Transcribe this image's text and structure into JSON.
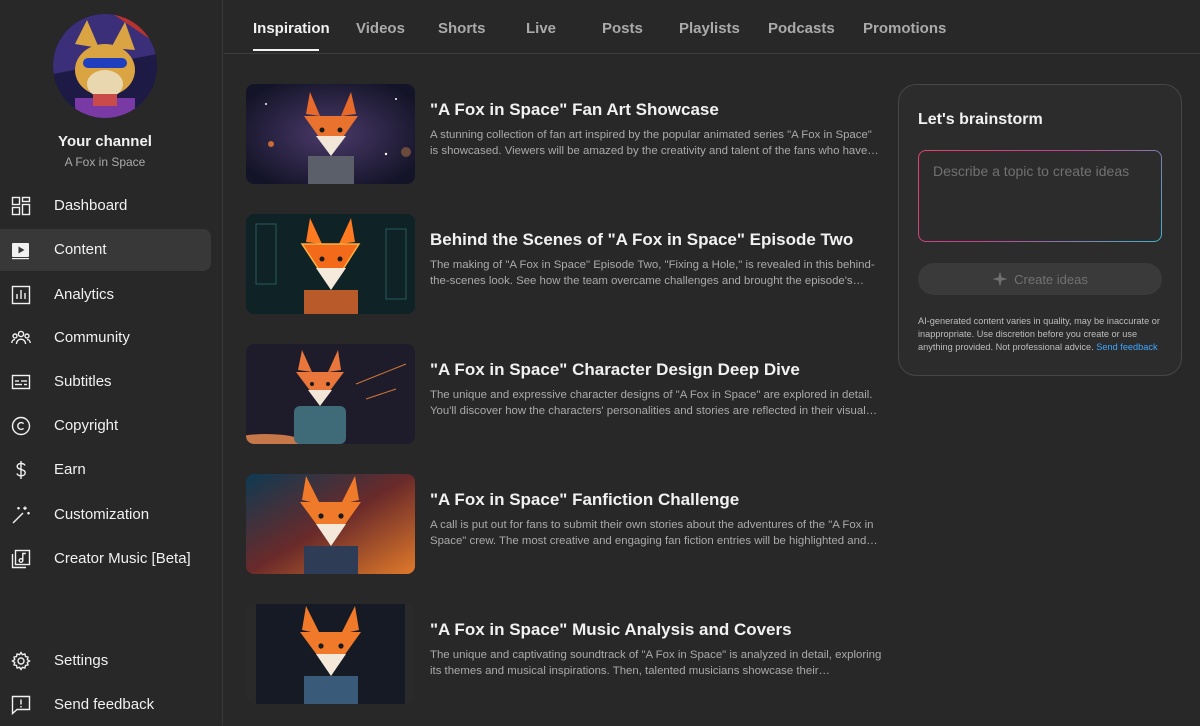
{
  "channel": {
    "title": "Your channel",
    "name": "A Fox in Space"
  },
  "nav": {
    "items": [
      {
        "label": "Dashboard",
        "icon": "dashboard-icon"
      },
      {
        "label": "Content",
        "icon": "content-icon",
        "active": true
      },
      {
        "label": "Analytics",
        "icon": "analytics-icon"
      },
      {
        "label": "Community",
        "icon": "community-icon"
      },
      {
        "label": "Subtitles",
        "icon": "subtitles-icon"
      },
      {
        "label": "Copyright",
        "icon": "copyright-icon"
      },
      {
        "label": "Earn",
        "icon": "dollar-icon"
      },
      {
        "label": "Customization",
        "icon": "magic-wand-icon"
      },
      {
        "label": "Creator Music [Beta]",
        "icon": "music-note-icon"
      }
    ],
    "bottom": [
      {
        "label": "Settings",
        "icon": "gear-icon"
      },
      {
        "label": "Send feedback",
        "icon": "feedback-icon"
      }
    ]
  },
  "tabs": [
    {
      "label": "Inspiration",
      "active": true
    },
    {
      "label": "Videos"
    },
    {
      "label": "Shorts"
    },
    {
      "label": "Live"
    },
    {
      "label": "Posts"
    },
    {
      "label": "Playlists"
    },
    {
      "label": "Podcasts"
    },
    {
      "label": "Promotions"
    }
  ],
  "ideas": [
    {
      "title": "\"A Fox in Space\" Fan Art Showcase",
      "description": "A stunning collection of fan art inspired by the popular animated series \"A Fox in Space\" is showcased. Viewers will be amazed by the creativity and talent of the fans who have…"
    },
    {
      "title": "Behind the Scenes of \"A Fox in Space\" Episode Two",
      "description": "The making of \"A Fox in Space\" Episode Two, \"Fixing a Hole,\" is revealed in this behind-the-scenes look. See how the team overcame challenges and brought the episode's unique…"
    },
    {
      "title": "\"A Fox in Space\" Character Design Deep Dive",
      "description": "The unique and expressive character designs of \"A Fox in Space\" are explored in detail. You'll discover how the characters' personalities and stories are reflected in their visual…"
    },
    {
      "title": "\"A Fox in Space\" Fanfiction Challenge",
      "description": "A call is put out for fans to submit their own stories about the adventures of the \"A Fox in Space\" crew. The most creative and engaging fan fiction entries will be highlighted and…"
    },
    {
      "title": "\"A Fox in Space\" Music Analysis and Covers",
      "description": "The unique and captivating soundtrack of \"A Fox in Space\" is analyzed in detail, exploring its themes and musical inspirations. Then, talented musicians showcase their…"
    }
  ],
  "brainstorm": {
    "title": "Let's brainstorm",
    "placeholder": "Describe a topic to create ideas",
    "button_label": "Create ideas",
    "disclaimer": "AI-generated content varies in quality, may be inaccurate or inappropriate. Use discretion before you create or use anything provided. Not professional advice.",
    "feedback_link": "Send feedback"
  },
  "colors": {
    "background": "#282828",
    "active_nav": "#383838",
    "link": "#3ea6ff",
    "gradient_start": "#e0456a",
    "gradient_end": "#3fb4c9"
  }
}
